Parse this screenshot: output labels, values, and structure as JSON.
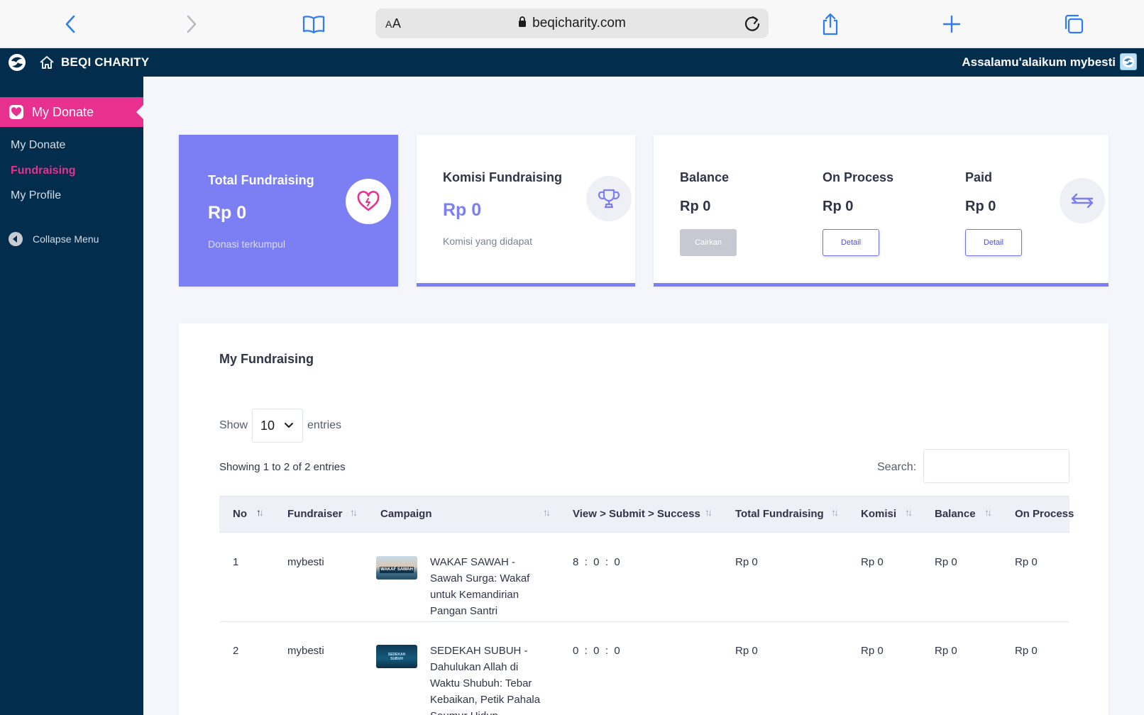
{
  "browser": {
    "url": "beqicharity.com",
    "aa_label": [
      "A",
      "A"
    ],
    "icons": {
      "back": "chevron-left-icon",
      "forward": "chevron-right-icon",
      "bookmarks": "book-icon",
      "lock": "lock-icon",
      "reload": "reload-icon",
      "share": "share-icon",
      "new_tab": "plus-icon",
      "tabs": "tabs-icon"
    }
  },
  "header": {
    "brand": "BEQI CHARITY",
    "greeting": "Assalamu'alaikum mybesti",
    "bg_color": "#022d4c"
  },
  "sidebar": {
    "active_section": "My Donate",
    "items": [
      {
        "label": "My Donate"
      },
      {
        "label": "Fundraising"
      },
      {
        "label": "My Profile"
      }
    ],
    "collapse_label": "Collapse Menu",
    "accent_color": "#e8318e"
  },
  "cards": {
    "total": {
      "title": "Total Fundraising",
      "amount": "Rp 0",
      "subtitle": "Donasi terkumpul"
    },
    "komisi": {
      "title": "Komisi Fundraising",
      "amount": "Rp 0",
      "subtitle": "Komisi yang didapat"
    },
    "balance": {
      "balance_label": "Balance",
      "balance_amount": "Rp 0",
      "cairkan": "Cairkan",
      "process_label": "On Process",
      "process_amount": "Rp 0",
      "process_detail": "Detail",
      "paid_label": "Paid",
      "paid_amount": "Rp 0",
      "paid_detail": "Detail"
    },
    "accent_color": "#7b7ff3"
  },
  "table": {
    "title": "My Fundraising",
    "show_label": "Show",
    "entries_label": "entries",
    "page_size": "10",
    "showing_text": "Showing 1 to 2 of 2 entries",
    "search_label": "Search:",
    "search_value": "",
    "columns": [
      "No",
      "Fundraiser",
      "Campaign",
      "View > Submit > Success",
      "Total Fundraising",
      "Komisi",
      "Balance",
      "On Process"
    ],
    "rows": [
      {
        "no": "1",
        "fundraiser": "mybesti",
        "campaign_lines": [
          "WAKAF SAWAH -",
          "Sawah Surga: Wakaf",
          "untuk Kemandirian",
          "Pangan Santri"
        ],
        "thumb_label": "WAKAF SAWAH",
        "vss": "8  :  0  :  0",
        "total": "Rp 0",
        "komisi": "Rp 0",
        "balance": "Rp 0",
        "process": "Rp 0"
      },
      {
        "no": "2",
        "fundraiser": "mybesti",
        "campaign_lines": [
          "SEDEKAH SUBUH -",
          "Dahulukan Allah di",
          "Waktu Shubuh: Tebar",
          "Kebaikan, Petik Pahala",
          "Seumur Hidup"
        ],
        "thumb_label": "SEDEKAH SUBUH",
        "vss": "0  :  0  :  0",
        "total": "Rp 0",
        "komisi": "Rp 0",
        "balance": "Rp 0",
        "process": "Rp 0"
      }
    ]
  }
}
